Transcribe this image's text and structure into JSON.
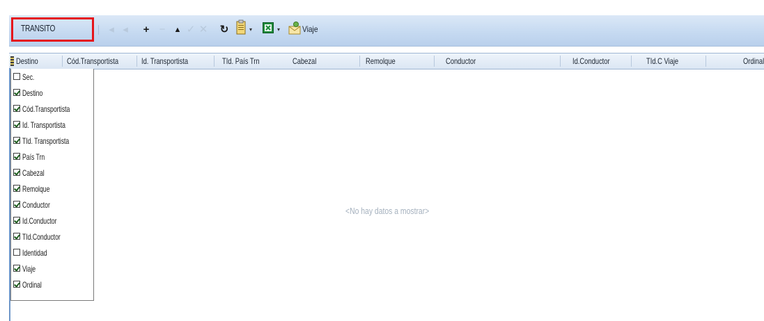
{
  "toolbar": {
    "title": "TRANSITO",
    "add_icon": "+",
    "remove_icon": "−",
    "up_icon": "▲",
    "refresh_icon": "↻",
    "viaje_label": "Viaje"
  },
  "grid": {
    "columns": [
      {
        "label": "Destino"
      },
      {
        "label": "Cód.Transportista"
      },
      {
        "label": "Id. Transportista"
      },
      {
        "label": "TId. País Trn"
      },
      {
        "label": "Cabezal"
      },
      {
        "label": "Remolque"
      },
      {
        "label": "Conductor"
      },
      {
        "label": "Id.Conductor"
      },
      {
        "label": "TId.C Viaje"
      },
      {
        "label": "Ordinal"
      }
    ],
    "empty_message": "<No hay datos a mostrar>"
  },
  "column_chooser": {
    "items": [
      {
        "label": "Sec.",
        "checked": false
      },
      {
        "label": "Destino",
        "checked": true
      },
      {
        "label": "Cód.Transportista",
        "checked": true
      },
      {
        "label": "Id. Transportista",
        "checked": true
      },
      {
        "label": "TId. Transportista",
        "checked": true
      },
      {
        "label": "País Trn",
        "checked": true
      },
      {
        "label": "Cabezal",
        "checked": true
      },
      {
        "label": "Remolque",
        "checked": true
      },
      {
        "label": "Conductor",
        "checked": true
      },
      {
        "label": "Id.Conductor",
        "checked": true
      },
      {
        "label": "TId.Conductor",
        "checked": true
      },
      {
        "label": "Identidad",
        "checked": false
      },
      {
        "label": "Viaje",
        "checked": true
      },
      {
        "label": "Ordinal",
        "checked": true
      }
    ]
  },
  "colors": {
    "highlight_border": "#e5161b",
    "toolbar_bg": "#c6daf1",
    "grid_border": "#6f97c9"
  }
}
